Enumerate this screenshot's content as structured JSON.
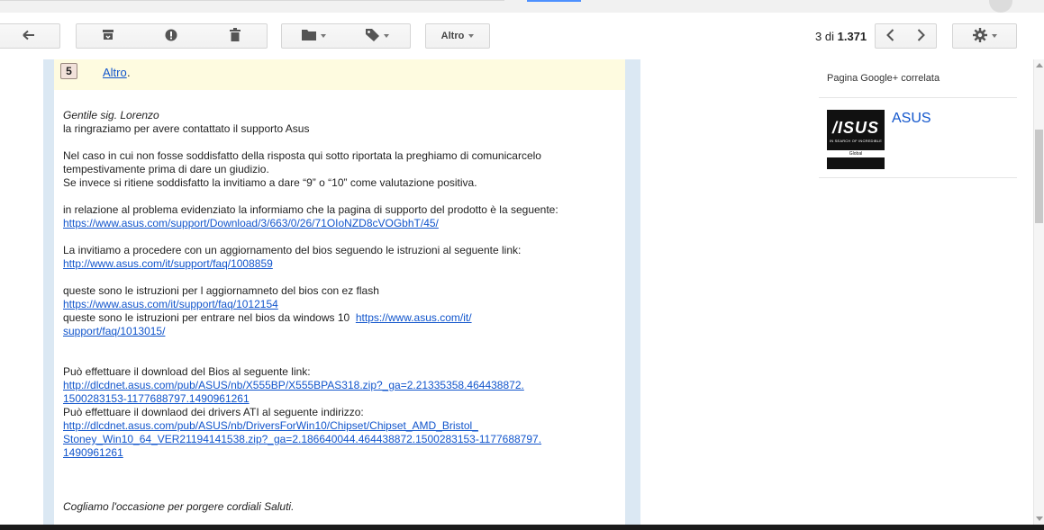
{
  "toolbar": {
    "back_icon": "arrow-left-icon",
    "archive_icon": "archive-icon",
    "spam_icon": "report-spam-icon",
    "delete_icon": "trash-icon",
    "folder_icon": "folder-icon",
    "label_icon": "label-icon",
    "more_label": "Altro",
    "counter_position": "3",
    "counter_of": "di",
    "counter_total": "1.371",
    "prev_icon": "chevron-left-icon",
    "next_icon": "chevron-right-icon",
    "settings_icon": "gear-icon"
  },
  "message": {
    "collapsed_count": "5",
    "collapsed_link": "Altro",
    "collapsed_dot": ".",
    "greeting": "Gentile sig. Lorenzo",
    "thanks": "la ringraziamo per avere contattato il supporto Asus",
    "p2_line1": "Nel caso in cui non fosse soddisfatto della risposta qui sotto riportata la preghiamo di comunicarcelo",
    "p2_line2": "tempestivamente prima di dare un giudizio.",
    "p2_line3": "Se invece si ritiene soddisfatto la invitiamo a dare “9” o “10” come valutazione positiva.",
    "p3_text": "in relazione al problema evidenziato la informiamo che la pagina di supporto del prodotto è la seguente:",
    "p3_link": "https://www.asus.com/support/Download/3/663/0/26/71OIoNZD8cVOGbhT/45/",
    "p4_text": "La invitiamo a procedere con un aggiornamento del bios  seguendo le istruzioni al seguente link:",
    "p4_link": "http://www.asus.com/it/support/faq/1008859",
    "p5_text": "queste sono le istruzioni per l aggiornamneto del bios con ez flash",
    "p5_link": "https://www.asus.com/it/support/faq/1012154",
    "p5_text2": "queste sono le istruzioni per entrare nel bios da windows 10",
    "p5_link2a": "https://www.asus.com/it/",
    "p5_link2b": "support/faq/1013015/",
    "p6_text": "Può effettuare il download del Bios al seguente link:",
    "p6_link_a": "http://dlcdnet.asus.com/pub/ASUS/nb/X555BP/X555BPAS318.zip?_ga=2.21335358.464438872.",
    "p6_link_b": "1500283153-1177688797.1490961261",
    "p6_text2": "Può effettuare il downlaod dei drivers ATI al seguente indirizzo:",
    "p6_link2_a": "http://dlcdnet.asus.com/pub/ASUS/nb/DriversForWin10/Chipset/Chipset_AMD_Bristol_",
    "p6_link2_b": "Stoney_Win10_64_VER21194141538.zip?_ga=2.186640044.464438872.1500283153-1177688797.",
    "p6_link2_c": "1490961261",
    "closing": "Cogliamo l'occasione per porgere cordiali Saluti."
  },
  "sidebar": {
    "title": "Pagina Google+ correlata",
    "logo_mark": "/ISUS",
    "logo_tagline": "IN SEARCH OF INCREDIBLE",
    "logo_region": "Global",
    "page_name": "ASUS"
  },
  "scrollbar": {
    "up_icon": "scroll-up-arrow-icon",
    "down_icon": "scroll-down-arrow-icon"
  }
}
